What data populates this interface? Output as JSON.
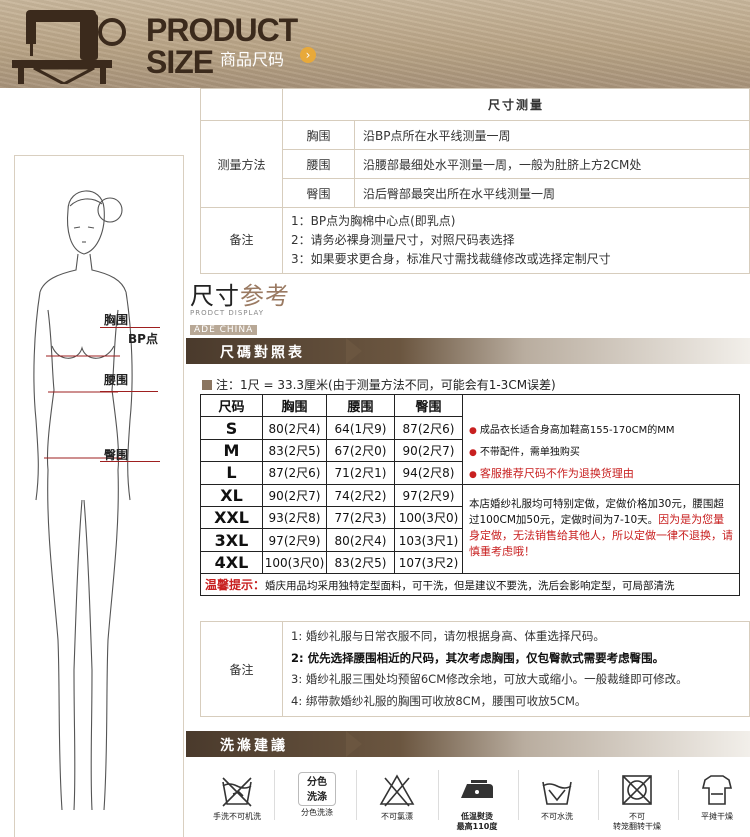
{
  "banner": {
    "line1": "PRODUCT",
    "line2": "SIZE",
    "cn": "商品尺码"
  },
  "figure": {
    "labels": {
      "chest": "胸围",
      "bp": "BP点",
      "waist": "腰围",
      "hip": "臀围"
    }
  },
  "measure": {
    "title": "尺寸测量",
    "method_head": "测量方法",
    "rows": [
      {
        "name": "胸围",
        "desc": "沿BP点所在水平线测量一周"
      },
      {
        "name": "腰围",
        "desc": "沿腰部最细处水平测量一周，一般为肚脐上方2CM处"
      },
      {
        "name": "臀围",
        "desc": "沿后臀部最突出所在水平线测量一周"
      }
    ],
    "note_head": "备注",
    "notes": [
      "1：BP点为胸棉中心点(即乳点)",
      "2：请务必裸身测量尺寸，对照尺码表选择",
      "3：如果要求更合身，标准尺寸需找裁缝修改或选择定制尺寸"
    ]
  },
  "ref_logo": {
    "main_a": "尺寸",
    "main_b": "参考",
    "sub1": "PRODCT DISPLAY",
    "sub2": "ADE CHINA"
  },
  "size_banner": "尺碼對照表",
  "size_note": "注：1尺 = 33.3厘米(由于测量方法不同，可能会有1-3CM误差)",
  "size_table": {
    "headers": [
      "尺码",
      "胸围",
      "腰围",
      "臀围"
    ],
    "rows": [
      [
        "S",
        "80(2尺4)",
        "64(1尺9)",
        "87(2尺6)"
      ],
      [
        "M",
        "83(2尺5)",
        "67(2尺0)",
        "90(2尺7)"
      ],
      [
        "L",
        "87(2尺6)",
        "71(2尺1)",
        "94(2尺8)"
      ],
      [
        "XL",
        "90(2尺7)",
        "74(2尺2)",
        "97(2尺9)"
      ],
      [
        "XXL",
        "93(2尺8)",
        "77(2尺3)",
        "100(3尺0)"
      ],
      [
        "3XL",
        "97(2尺9)",
        "80(2尺4)",
        "103(3尺1)"
      ],
      [
        "4XL",
        "100(3尺0)",
        "83(2尺5)",
        "107(3尺2)"
      ]
    ],
    "side_notes": [
      "成品衣长适合身高加鞋高155-170CM的MM",
      "不带配件，需单独购买",
      "客服推荐尺码不作为退换货理由"
    ],
    "custom_a": "本店婚纱礼服均可特别定做，定做价格加30元，腰围超过100CM加50元，定做时间为7-10天。",
    "custom_b": "因为是为您量身定做，无法销售给其他人，所以定做一律不退换，请慎重考虑哦！",
    "warm_key": "温馨提示：",
    "warm_text": "婚庆用品均采用独特定型面料，可干洗，但是建议不要洗，洗后会影响定型，可局部清洗"
  },
  "notes2": {
    "head": "备注",
    "items": [
      "1: 婚纱礼服与日常衣服不同，请勿根据身高、体重选择尺码。",
      "2: 优先选择腰围相近的尺码，其次考虑胸围，仅包臀款式需要考虑臀围。",
      "3: 婚纱礼服三围处均预留6CM修改余地，可放大或缩小。一般裁缝即可修改。",
      "4: 绑带款婚纱礼服的胸围可收放8CM，腰围可收放5CM。"
    ]
  },
  "wash_banner": "洗滌建議",
  "wash": [
    {
      "icon": "hand-wash-crossed-icon",
      "cap": "手洗不可机洗"
    },
    {
      "icon": "separate-wash-tag-icon",
      "tag": "分色\n洗涤",
      "cap": "分色洗涤"
    },
    {
      "icon": "no-bleach-icon",
      "cap": "不可氯漂"
    },
    {
      "icon": "low-iron-icon",
      "cap": "低温熨烫\n最高110度"
    },
    {
      "icon": "no-water-wash-icon",
      "cap": "不可水洗"
    },
    {
      "icon": "no-tumble-dry-icon",
      "cap": "不可\n转笼翻转干燥"
    },
    {
      "icon": "flat-dry-icon",
      "cap": "平摊干燥"
    }
  ],
  "colors": {
    "accent_red": "#c82020",
    "banner_brown": "#4a3a2c",
    "border": "#d7cdbd"
  }
}
